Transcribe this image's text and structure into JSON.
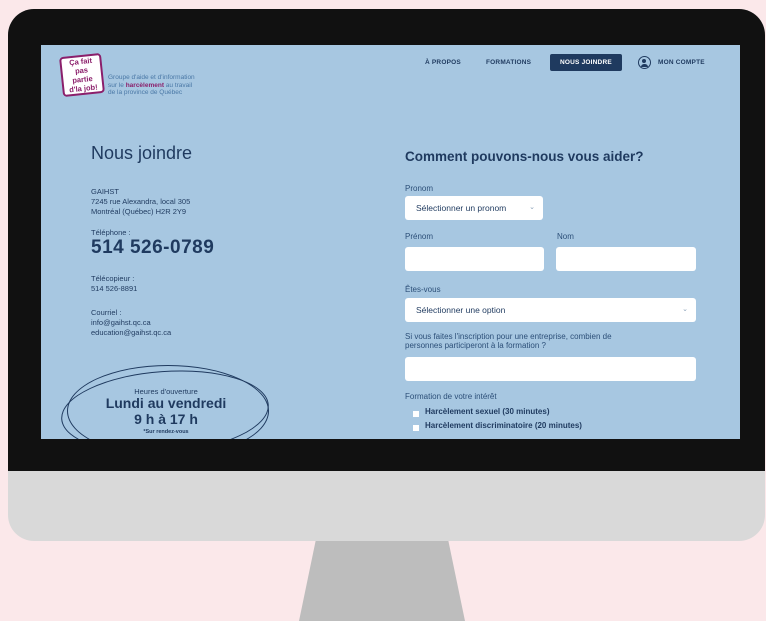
{
  "logo": {
    "text": "Ça fait pas partie d'la job!"
  },
  "tagline": {
    "line1": "Groupe d'aide et d'information",
    "line2a": "sur le ",
    "line2b": "harcèlement",
    "line2c": " au travail",
    "line3": "de la province de Québec"
  },
  "nav": {
    "a_propos": "À PROPOS",
    "formations": "FORMATIONS",
    "nous_joindre": "NOUS JOINDRE",
    "mon_compte": "MON COMPTE"
  },
  "contact": {
    "title": "Nous joindre",
    "org": "GAIHST",
    "address1": "7245 rue Alexandra, local 305",
    "address2": "Montréal (Québec) H2R 2Y9",
    "phone_label": "Téléphone :",
    "phone": "514 526-0789",
    "fax_label": "Télécopieur :",
    "fax": "514 526-8891",
    "email_label": "Courriel :",
    "email1": "info@gaihst.qc.ca",
    "email2": "education@gaihst.qc.ca"
  },
  "hours": {
    "label": "Heures d'ouverture",
    "days": "Lundi au vendredi",
    "time": "9 h à 17 h",
    "note": "*Sur rendez-vous"
  },
  "form": {
    "title": "Comment pouvons-nous vous aider?",
    "pronom_label": "Pronom",
    "pronom_value": "Sélectionner un pronom",
    "prenom_label": "Prénom",
    "nom_label": "Nom",
    "etes_vous_label": "Êtes-vous",
    "etes_vous_value": "Sélectionner une option",
    "entreprise_label_1": "Si vous faites l'inscription pour une entreprise, combien de",
    "entreprise_label_2": "personnes participeront à la formation ?",
    "formation_label": "Formation de votre intérêt",
    "option1": "Harcèlement sexuel (30 minutes)",
    "option2": "Harcèlement discriminatoire (20 minutes)"
  },
  "colors": {
    "page_bg": "#fbe8ea",
    "screen_bg": "#a7c7e1",
    "navy": "#1f3a5f",
    "brand": "#8b1f6b"
  },
  "icons": {
    "user": "user-circle-icon",
    "chevron": "chevron-down-icon"
  }
}
